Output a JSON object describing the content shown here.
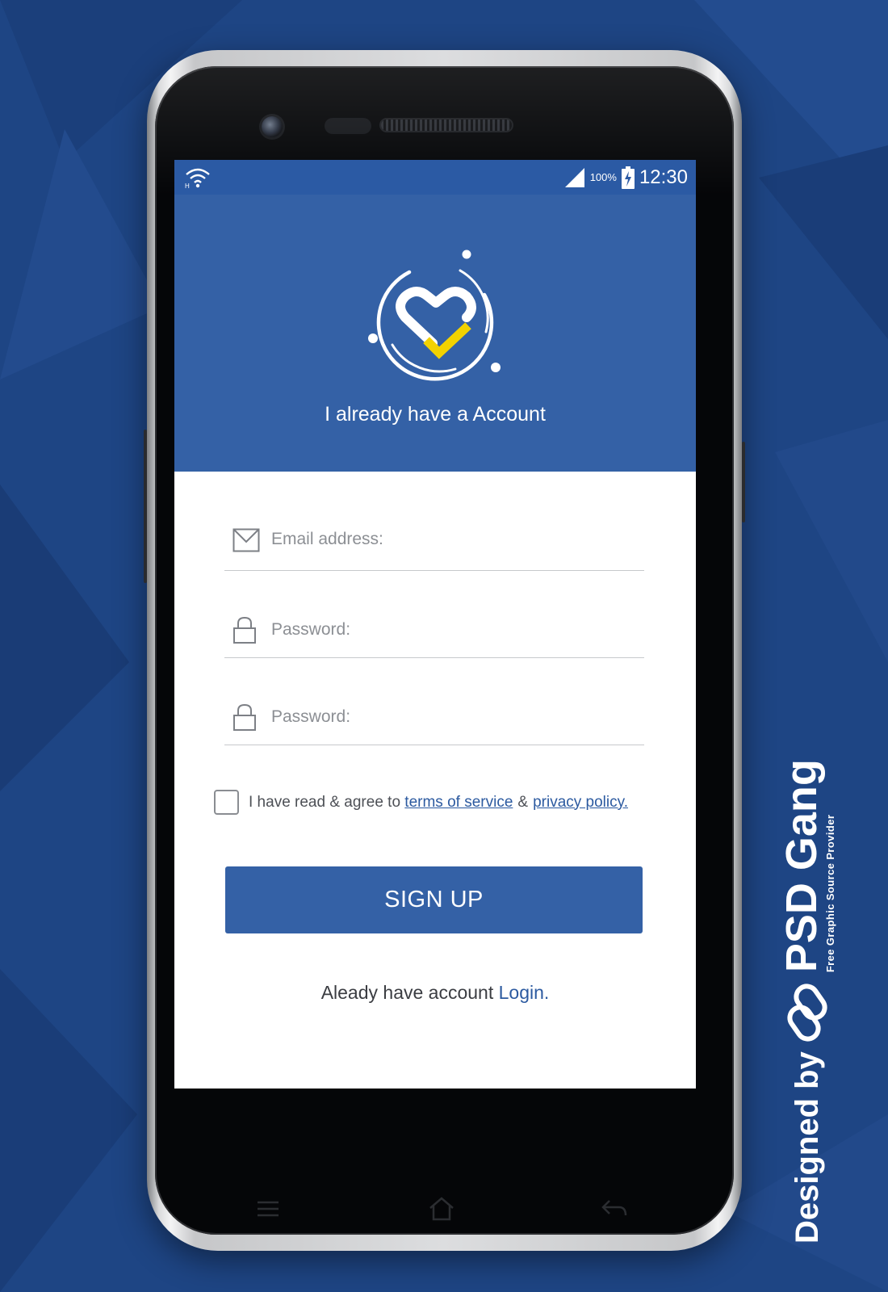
{
  "colors": {
    "page_background": "#1e4584",
    "brand_blue": "#3461a6",
    "link_blue": "#2c5aa0",
    "check_yellow": "#f2d200"
  },
  "status_bar": {
    "wifi_icon": "wifi-icon",
    "signal_icon": "signal-icon",
    "battery_percent": "100%",
    "battery_icon": "battery-charging-icon",
    "time": "12:30"
  },
  "header": {
    "logo_icon": "heart-check-logo-icon",
    "title": "I already have a Account"
  },
  "form": {
    "email": {
      "icon": "envelope-icon",
      "placeholder": "Email address:",
      "value": ""
    },
    "password": {
      "icon": "lock-icon",
      "placeholder": "Password:",
      "value": ""
    },
    "confirm_password": {
      "icon": "lock-icon",
      "placeholder": "Password:",
      "value": ""
    }
  },
  "agreement": {
    "checked": false,
    "text_before": "I have read & agree to",
    "terms_link": "terms of service",
    "separator": "&",
    "privacy_link": "privacy policy."
  },
  "signup_button": {
    "label": "SIGN UP"
  },
  "footer": {
    "prompt": "Aleady have account",
    "login_link": "Login."
  },
  "hardware_nav": {
    "menu_icon": "menu-icon",
    "home_icon": "home-icon",
    "back_icon": "back-icon"
  },
  "branding": {
    "designed_by": "Designed by",
    "logo_icon": "psd-gang-link-logo-icon",
    "name": "PSD Gang",
    "tagline": "Free Graphic Source Provider"
  }
}
